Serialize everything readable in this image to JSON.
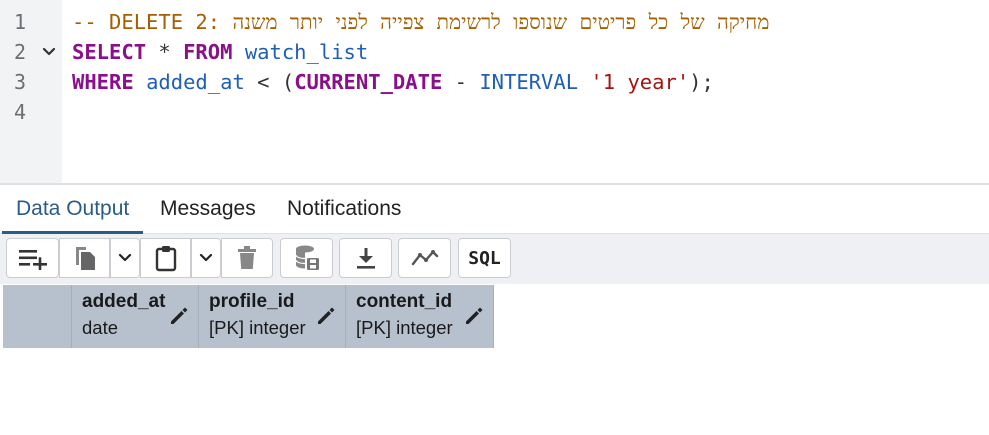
{
  "editor": {
    "lines": [
      {
        "number": "1",
        "comment_prefix": "-- DELETE 2: ",
        "comment_hebrew": "מחיקה של כל פריטים שנוספו לרשימת צפייה לפני יותר משנה"
      },
      {
        "number": "2",
        "kw1": "SELECT",
        "star": "*",
        "kw2": "FROM",
        "table": "watch_list"
      },
      {
        "number": "3",
        "kw1": "WHERE",
        "column": "added_at",
        "lt": "<",
        "open_paren": "(",
        "func": "CURRENT_DATE",
        "minus": "-",
        "interval_kw": "INTERVAL",
        "literal": "'1 year'",
        "close": ");"
      },
      {
        "number": "4"
      }
    ],
    "fold_icon": "chevron-down-icon"
  },
  "results": {
    "tabs": [
      {
        "label": "Data Output",
        "active": true
      },
      {
        "label": "Messages",
        "active": false
      },
      {
        "label": "Notifications",
        "active": false
      }
    ],
    "toolbar": {
      "buttons": [
        {
          "name": "add-row-button",
          "icon": "add-row-icon"
        },
        {
          "name": "copy-button",
          "icon": "copy-icon"
        },
        {
          "name": "copy-options-button",
          "icon": "chevron-down-icon"
        },
        {
          "name": "paste-button",
          "icon": "paste-icon"
        },
        {
          "name": "paste-options-button",
          "icon": "chevron-down-icon"
        },
        {
          "name": "delete-button",
          "icon": "trash-icon"
        },
        {
          "name": "save-data-button",
          "icon": "database-save-icon"
        },
        {
          "name": "download-button",
          "icon": "download-icon"
        },
        {
          "name": "graph-button",
          "icon": "line-chart-icon"
        },
        {
          "name": "sql-button",
          "icon": "sql-icon",
          "label": "SQL"
        }
      ]
    },
    "columns": [
      {
        "name": "added_at",
        "type": "date"
      },
      {
        "name": "profile_id",
        "type": "[PK] integer"
      },
      {
        "name": "content_id",
        "type": "[PK] integer"
      }
    ]
  },
  "colors": {
    "active_tab": "#2b5c86",
    "keyword": "#8a0f8a",
    "identifier": "#1f5fb5",
    "comment": "#a55f00",
    "string": "#a31515",
    "header_bg": "#b7c1cd"
  }
}
